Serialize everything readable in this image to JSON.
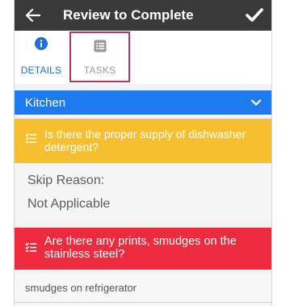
{
  "header": {
    "title": "Review to Complete",
    "back_icon": "arrow-left-icon",
    "done_icon": "checkmark-icon",
    "background": "#3a3a3a"
  },
  "tabs": [
    {
      "label": "DETAILS",
      "icon": "info-circle-icon",
      "active": true,
      "color": "#1e6fdb"
    },
    {
      "label": "TASKS",
      "icon": "list-icon",
      "active": false,
      "color": "#9a9a9a"
    }
  ],
  "section": {
    "label": "Kitchen",
    "icon": "chevron-down-icon",
    "color": "#1e7bef"
  },
  "tasks": [
    {
      "text": "Is there the proper supply of dishwasher detergent?",
      "icon": "checklist-icon",
      "color": "#f6bf2f"
    },
    {
      "text": "Are there any prints, smudges on the stainless steel?",
      "icon": "checklist-icon",
      "color": "#ee2a3e"
    }
  ],
  "skip": {
    "label": "Skip Reason:",
    "value": "Not Applicable"
  },
  "note": {
    "text": "smudges on refrigerator"
  }
}
